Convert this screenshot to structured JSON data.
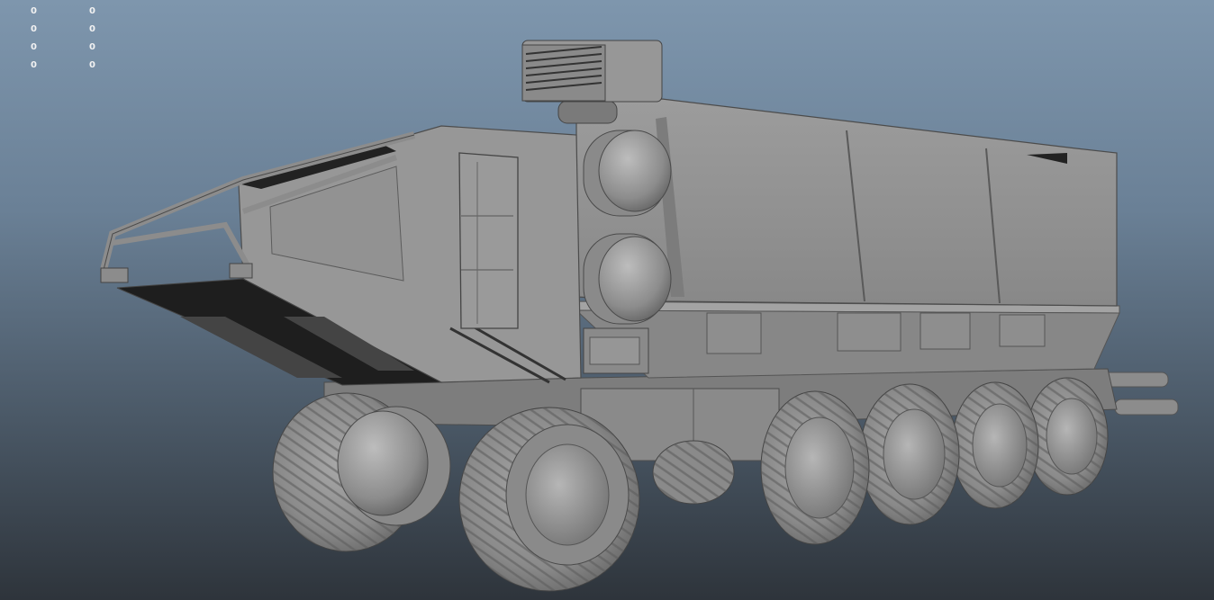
{
  "viewport": {
    "background_top": "#7e96ad",
    "background_bottom": "#2e343b",
    "model_color": "#8f8f8f"
  },
  "hud": {
    "rows": [
      {
        "label": "0",
        "value": "0"
      },
      {
        "label": "0",
        "value": "0"
      },
      {
        "label": "0",
        "value": "0"
      },
      {
        "label": "0",
        "value": "0"
      }
    ]
  },
  "model": {
    "type": "vehicle",
    "description_icon": "six-wheel-armored-rover"
  }
}
